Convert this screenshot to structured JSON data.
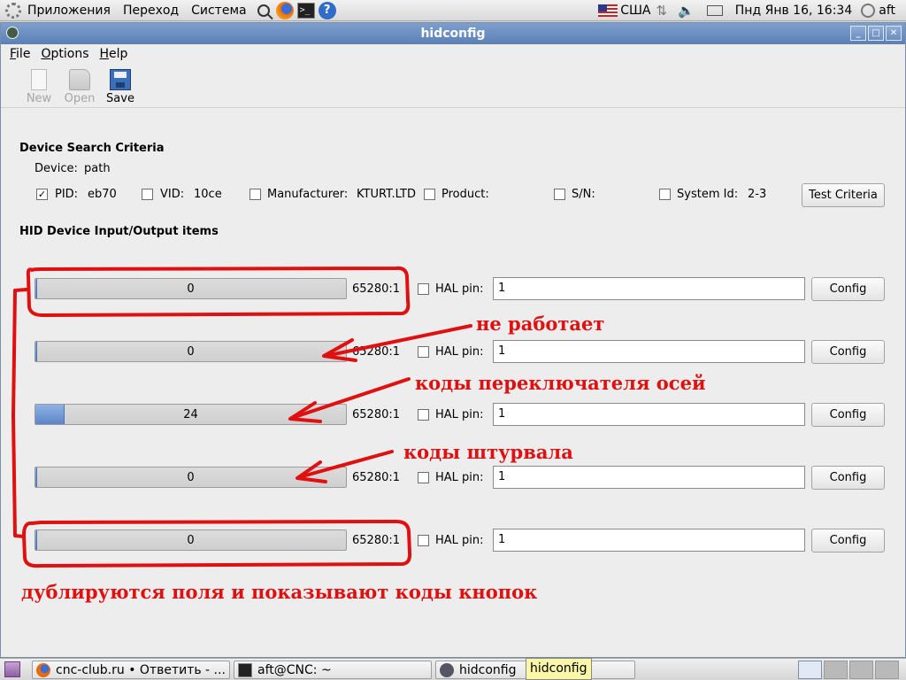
{
  "top_panel": {
    "menus": [
      "Приложения",
      "Переход",
      "Система"
    ],
    "keyboard_layout": "США",
    "datetime": "Пнд Янв 16, 16:34",
    "user": "aft"
  },
  "window": {
    "title": "hidconfig",
    "menus": [
      {
        "mnemonic": "F",
        "rest": "ile"
      },
      {
        "mnemonic": "O",
        "rest": "ptions"
      },
      {
        "mnemonic": "H",
        "rest": "elp"
      }
    ],
    "toolbar": {
      "new": "New",
      "open": "Open",
      "save": "Save"
    }
  },
  "search": {
    "title": "Device Search Criteria",
    "device_label": "Device:",
    "device_value": "path",
    "criteria": [
      {
        "label": "PID:",
        "value": "eb70",
        "checked": true
      },
      {
        "label": "VID:",
        "value": "10ce",
        "checked": false
      },
      {
        "label": "Manufacturer:",
        "value": "KTURT.LTD",
        "checked": false
      },
      {
        "label": "Product:",
        "value": "",
        "checked": false
      },
      {
        "label": "S/N:",
        "value": "",
        "checked": false
      },
      {
        "label": "System Id:",
        "value": "2-3",
        "checked": false
      }
    ],
    "test_button": "Test Criteria"
  },
  "io": {
    "title": "HID Device Input/Output items",
    "hal_label": "HAL pin:",
    "config_label": "Config",
    "items": [
      {
        "value": "0",
        "fraction": 0.005,
        "scale": "65280:1",
        "hal_pin": "1",
        "checked": false
      },
      {
        "value": "0",
        "fraction": 0.005,
        "scale": "65280:1",
        "hal_pin": "1",
        "checked": false
      },
      {
        "value": "24",
        "fraction": 0.094,
        "scale": "65280:1",
        "hal_pin": "1",
        "checked": false
      },
      {
        "value": "0",
        "fraction": 0.005,
        "scale": "65280:1",
        "hal_pin": "1",
        "checked": false
      },
      {
        "value": "0",
        "fraction": 0.005,
        "scale": "65280:1",
        "hal_pin": "1",
        "checked": false
      }
    ]
  },
  "annotations": {
    "not_working": "не работает",
    "axis_switch_codes": "коды переключателя осей",
    "handwheel_codes": "коды штурвала",
    "duplicated": "дублируются поля и показывают коды кнопок"
  },
  "taskbar": {
    "tasks": [
      "cnc-club.ru • Ответить - ...",
      "aft@CNC: ~",
      "hidconfig"
    ],
    "tooltip": "hidconfig"
  },
  "colors": {
    "annotation": "#e01010",
    "titlebar": "#6a8cc0",
    "progress_fill": "#6d93d0"
  }
}
